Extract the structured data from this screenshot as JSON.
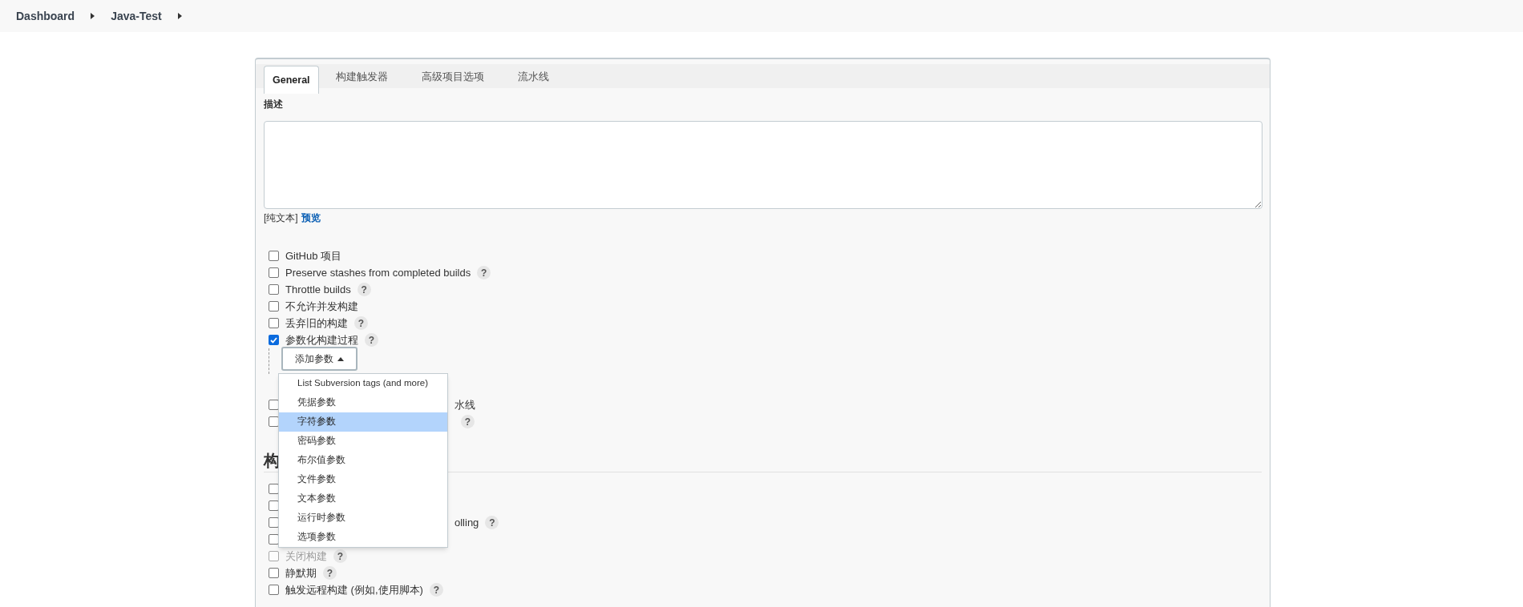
{
  "breadcrumb": [
    {
      "label": "Dashboard"
    },
    {
      "label": "Java-Test"
    }
  ],
  "tabs": [
    {
      "label": "General",
      "selected": true
    },
    {
      "label": "构建触发器",
      "selected": false
    },
    {
      "label": "高级项目选项",
      "selected": false
    },
    {
      "label": "流水线",
      "selected": false
    }
  ],
  "description": {
    "label": "描述",
    "format": "[纯文本]",
    "preview_link": "预览"
  },
  "general_options": [
    {
      "kind": "full",
      "label": "GitHub 项目",
      "checked": false
    },
    {
      "kind": "full",
      "label": "Preserve stashes from completed builds",
      "checked": false,
      "help": "?"
    },
    {
      "kind": "full",
      "label": "Throttle builds",
      "checked": false,
      "help": "?"
    },
    {
      "kind": "full",
      "label": "不允许并发构建",
      "checked": false
    },
    {
      "kind": "full",
      "label": "丢弃旧的构建",
      "checked": false,
      "help": "?"
    },
    {
      "kind": "full",
      "label": "参数化构建过程",
      "checked": true,
      "help": "?"
    }
  ],
  "add_parameter_button": {
    "label": "添加参数"
  },
  "parameter_menu": [
    {
      "label": "List Subversion tags (and more)",
      "selected": false
    },
    {
      "label": "凭据参数",
      "selected": false
    },
    {
      "label": "字符参数",
      "selected": true
    },
    {
      "label": "密码参数",
      "selected": false
    },
    {
      "label": "布尔值参数",
      "selected": false
    },
    {
      "label": "文件参数",
      "selected": false
    },
    {
      "label": "文本参数",
      "selected": false
    },
    {
      "label": "运行时参数",
      "selected": false
    },
    {
      "label": "选项参数",
      "selected": false
    }
  ],
  "more_options": [
    {
      "kind": "partial",
      "label": "水线",
      "checked": false
    },
    {
      "kind": "partial",
      "checked": false,
      "help": "?"
    }
  ],
  "triggers_heading": "构",
  "trigger_options": [
    {
      "kind": "partial",
      "checked": false,
      "disabled": false
    },
    {
      "kind": "partial",
      "checked": false,
      "disabled": false
    },
    {
      "kind": "partial",
      "label": "olling",
      "checked": false,
      "help": "?",
      "disabled": false
    },
    {
      "kind": "partial",
      "checked": false,
      "disabled": false
    },
    {
      "kind": "full",
      "label": "关闭构建",
      "checked": false,
      "help": "?",
      "disabled": true
    },
    {
      "kind": "full",
      "label": "静默期",
      "checked": false,
      "help": "?",
      "disabled": false
    },
    {
      "kind": "full",
      "label": "触发远程构建 (例如,使用脚本)",
      "checked": false,
      "help": "?",
      "disabled": false
    }
  ]
}
